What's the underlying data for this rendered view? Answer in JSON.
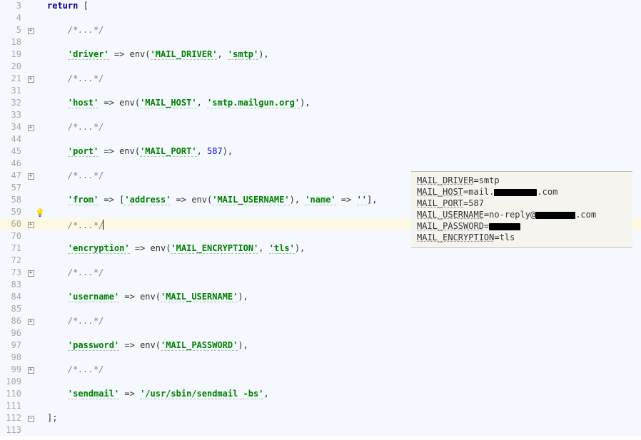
{
  "editor": {
    "lines": [
      {
        "n": 3,
        "fold": "",
        "mark": "",
        "bg": "default",
        "tokens": [
          [
            "kw",
            "return"
          ],
          [
            "punc",
            " ["
          ]
        ]
      },
      {
        "n": 4,
        "fold": "",
        "mark": "",
        "bg": "default",
        "tokens": []
      },
      {
        "n": 5,
        "fold": "+",
        "mark": "",
        "bg": "default",
        "tokens": [
          [
            "pad",
            "    "
          ],
          [
            "cm",
            "/*...*/"
          ]
        ]
      },
      {
        "n": 18,
        "fold": "",
        "mark": "",
        "bg": "default",
        "tokens": []
      },
      {
        "n": 19,
        "fold": "",
        "mark": "",
        "bg": "default",
        "tokens": [
          [
            "pad",
            "    "
          ],
          [
            "str",
            "'driver'"
          ],
          [
            "op",
            " => "
          ],
          [
            "punc",
            "env("
          ],
          [
            "str",
            "'MAIL_DRIVER'"
          ],
          [
            "punc",
            ", "
          ],
          [
            "str",
            "'smtp'"
          ],
          [
            "punc",
            "),"
          ]
        ]
      },
      {
        "n": 20,
        "fold": "",
        "mark": "",
        "bg": "default",
        "tokens": []
      },
      {
        "n": 21,
        "fold": "+",
        "mark": "",
        "bg": "default",
        "tokens": [
          [
            "pad",
            "    "
          ],
          [
            "cm",
            "/*...*/"
          ]
        ]
      },
      {
        "n": 31,
        "fold": "",
        "mark": "",
        "bg": "default",
        "tokens": []
      },
      {
        "n": 32,
        "fold": "",
        "mark": "",
        "bg": "default",
        "tokens": [
          [
            "pad",
            "    "
          ],
          [
            "str",
            "'host'"
          ],
          [
            "op",
            " => "
          ],
          [
            "punc",
            "env("
          ],
          [
            "str",
            "'MAIL_HOST'"
          ],
          [
            "punc",
            ", "
          ],
          [
            "str",
            "'smtp.mailgun.org'"
          ],
          [
            "punc",
            "),"
          ]
        ]
      },
      {
        "n": 33,
        "fold": "",
        "mark": "",
        "bg": "default",
        "tokens": []
      },
      {
        "n": 34,
        "fold": "+",
        "mark": "",
        "bg": "default",
        "tokens": [
          [
            "pad",
            "    "
          ],
          [
            "cm",
            "/*...*/"
          ]
        ]
      },
      {
        "n": 44,
        "fold": "",
        "mark": "",
        "bg": "default",
        "tokens": []
      },
      {
        "n": 45,
        "fold": "",
        "mark": "",
        "bg": "default",
        "tokens": [
          [
            "pad",
            "    "
          ],
          [
            "str",
            "'port'"
          ],
          [
            "op",
            " => "
          ],
          [
            "punc",
            "env("
          ],
          [
            "str",
            "'MAIL_PORT'"
          ],
          [
            "punc",
            ", "
          ],
          [
            "num",
            "587"
          ],
          [
            "punc",
            "),"
          ]
        ]
      },
      {
        "n": 46,
        "fold": "",
        "mark": "",
        "bg": "default",
        "tokens": []
      },
      {
        "n": 47,
        "fold": "+",
        "mark": "",
        "bg": "default",
        "tokens": [
          [
            "pad",
            "    "
          ],
          [
            "cm",
            "/*...*/"
          ]
        ]
      },
      {
        "n": 57,
        "fold": "",
        "mark": "",
        "bg": "default",
        "tokens": []
      },
      {
        "n": 58,
        "fold": "",
        "mark": "",
        "bg": "default",
        "tokens": [
          [
            "pad",
            "    "
          ],
          [
            "str",
            "'from'"
          ],
          [
            "op",
            " => ["
          ],
          [
            "str",
            "'address'"
          ],
          [
            "op",
            " => "
          ],
          [
            "punc",
            "env("
          ],
          [
            "str",
            "'MAIL_USERNAME'"
          ],
          [
            "punc",
            "), "
          ],
          [
            "str",
            "'name'"
          ],
          [
            "op",
            " => "
          ],
          [
            "str",
            "''"
          ],
          [
            "punc",
            "],"
          ]
        ]
      },
      {
        "n": 59,
        "fold": "",
        "mark": "bulb",
        "bg": "default",
        "tokens": []
      },
      {
        "n": 60,
        "fold": "+",
        "mark": "",
        "bg": "current",
        "tokens": [
          [
            "pad",
            "    "
          ],
          [
            "cm",
            "/*...*/"
          ],
          [
            "caret",
            ""
          ]
        ]
      },
      {
        "n": 70,
        "fold": "",
        "mark": "",
        "bg": "default",
        "tokens": []
      },
      {
        "n": 71,
        "fold": "",
        "mark": "",
        "bg": "default",
        "tokens": [
          [
            "pad",
            "    "
          ],
          [
            "str",
            "'encryption'"
          ],
          [
            "op",
            " => "
          ],
          [
            "punc",
            "env("
          ],
          [
            "str",
            "'MAIL_ENCRYPTION'"
          ],
          [
            "punc",
            ", "
          ],
          [
            "str",
            "'tls'"
          ],
          [
            "punc",
            "),"
          ]
        ]
      },
      {
        "n": 72,
        "fold": "",
        "mark": "",
        "bg": "default",
        "tokens": []
      },
      {
        "n": 73,
        "fold": "+",
        "mark": "",
        "bg": "default",
        "tokens": [
          [
            "pad",
            "    "
          ],
          [
            "cm",
            "/*...*/"
          ]
        ]
      },
      {
        "n": 83,
        "fold": "",
        "mark": "",
        "bg": "default",
        "tokens": []
      },
      {
        "n": 84,
        "fold": "",
        "mark": "",
        "bg": "default",
        "tokens": [
          [
            "pad",
            "    "
          ],
          [
            "str",
            "'username'"
          ],
          [
            "op",
            " => "
          ],
          [
            "punc",
            "env("
          ],
          [
            "str",
            "'MAIL_USERNAME'"
          ],
          [
            "punc",
            "),"
          ]
        ]
      },
      {
        "n": 85,
        "fold": "",
        "mark": "",
        "bg": "default",
        "tokens": []
      },
      {
        "n": 86,
        "fold": "+",
        "mark": "",
        "bg": "default",
        "tokens": [
          [
            "pad",
            "    "
          ],
          [
            "cm",
            "/*...*/"
          ]
        ]
      },
      {
        "n": 96,
        "fold": "",
        "mark": "",
        "bg": "default",
        "tokens": []
      },
      {
        "n": 97,
        "fold": "",
        "mark": "",
        "bg": "default",
        "tokens": [
          [
            "pad",
            "    "
          ],
          [
            "str",
            "'password'"
          ],
          [
            "op",
            " => "
          ],
          [
            "punc",
            "env("
          ],
          [
            "str",
            "'MAIL_PASSWORD'"
          ],
          [
            "punc",
            "),"
          ]
        ]
      },
      {
        "n": 98,
        "fold": "",
        "mark": "",
        "bg": "default",
        "tokens": []
      },
      {
        "n": 99,
        "fold": "+",
        "mark": "",
        "bg": "default",
        "tokens": [
          [
            "pad",
            "    "
          ],
          [
            "cm",
            "/*...*/"
          ]
        ]
      },
      {
        "n": 109,
        "fold": "",
        "mark": "",
        "bg": "default",
        "tokens": []
      },
      {
        "n": 110,
        "fold": "",
        "mark": "",
        "bg": "default",
        "tokens": [
          [
            "pad",
            "    "
          ],
          [
            "str",
            "'sendmail'"
          ],
          [
            "op",
            " => "
          ],
          [
            "str",
            "'/usr/sbin/sendmail -bs'"
          ],
          [
            "punc",
            ","
          ]
        ]
      },
      {
        "n": 111,
        "fold": "",
        "mark": "",
        "bg": "default",
        "tokens": []
      },
      {
        "n": 112,
        "fold": "-",
        "mark": "",
        "bg": "default",
        "tokens": [
          [
            "punc",
            "];"
          ]
        ]
      },
      {
        "n": 113,
        "fold": "",
        "mark": "",
        "bg": "default",
        "tokens": []
      }
    ]
  },
  "popup": {
    "rows": [
      {
        "key": "MAIL_DRIVER",
        "eq": "=",
        "value": "smtp",
        "redact": ""
      },
      {
        "key": "MAIL_HOST",
        "eq": "=",
        "value": "mail.",
        "redact": "a",
        "suffix": ".com"
      },
      {
        "key": "MAIL_PORT",
        "eq": "=",
        "value": "587",
        "redact": ""
      },
      {
        "key": "MAIL_USERNAME",
        "eq": "=",
        "value": "no-reply@",
        "redact": "b",
        "suffix": ".com"
      },
      {
        "key": "MAIL_PASSWORD",
        "eq": "=",
        "value": "",
        "redact": "c"
      },
      {
        "key": "MAIL_ENCRYPTION",
        "eq": "=",
        "value": "tls",
        "redact": ""
      }
    ]
  }
}
